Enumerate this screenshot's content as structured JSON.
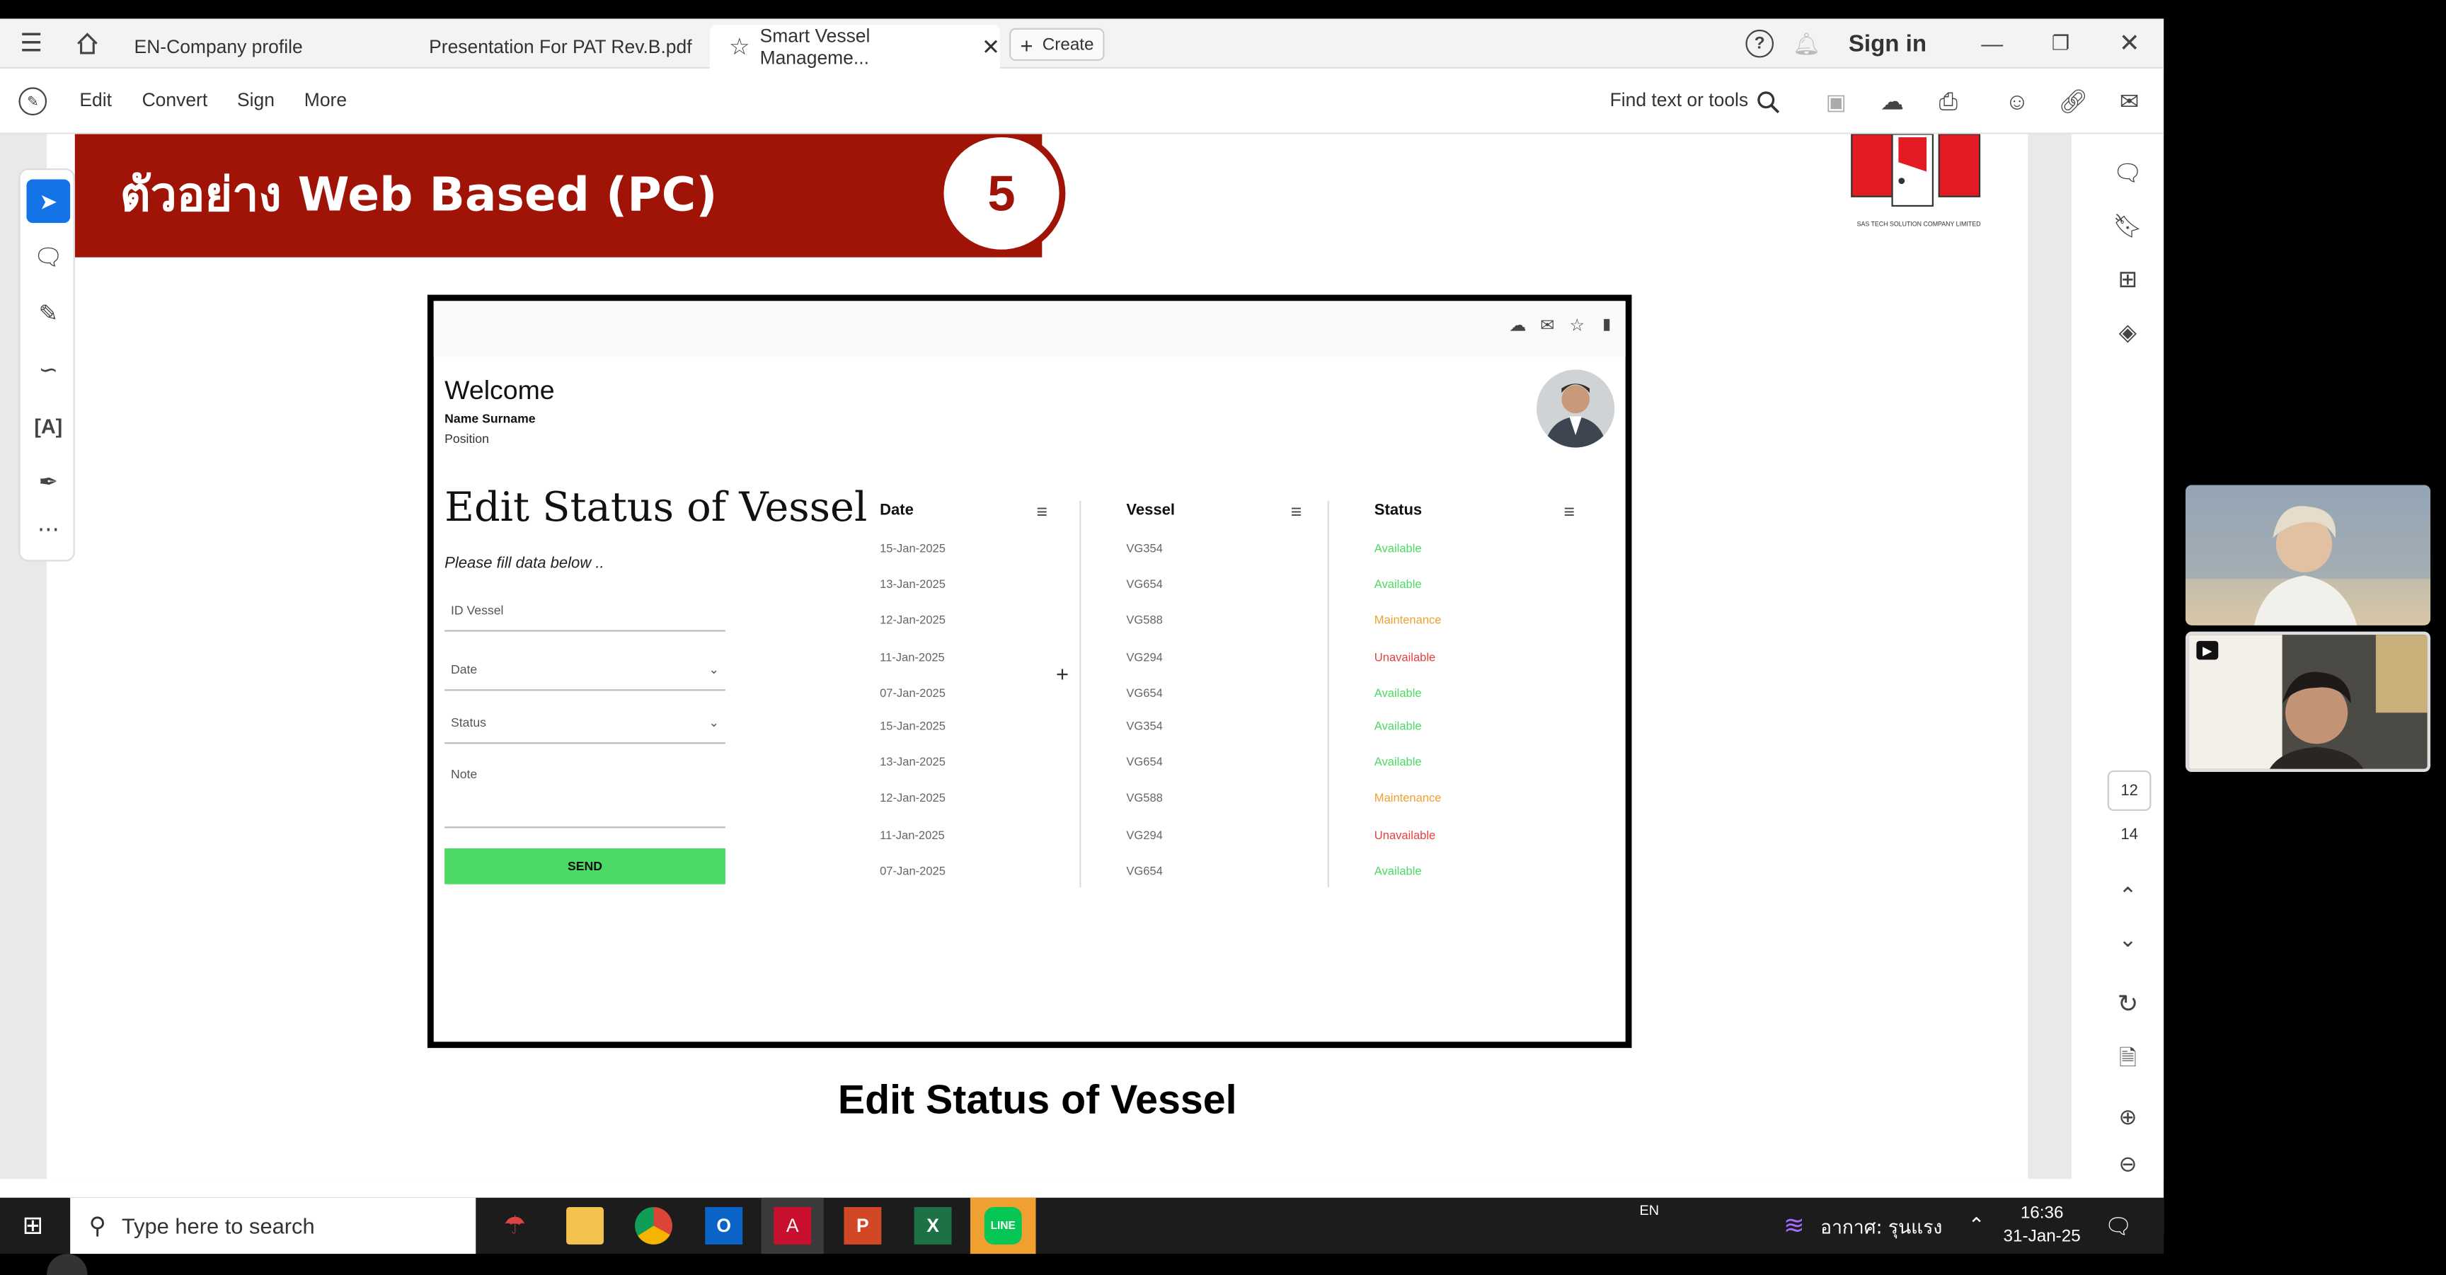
{
  "tabs": [
    {
      "label": "EN-Company profile"
    },
    {
      "label": "Presentation For PAT Rev.B.pdf"
    },
    {
      "label": "Smart Vessel Manageme..."
    }
  ],
  "create_label": "Create",
  "signin_label": "Sign in",
  "menu": {
    "edit": "Edit",
    "convert": "Convert",
    "sign": "Sign",
    "more": "More"
  },
  "find_label": "Find text or tools",
  "slide": {
    "banner": "ตัวอย่าง Web Based (PC)",
    "number": "5",
    "logo_text": "SAS TECH SOLUTION COMPANY LIMITED",
    "caption": "Edit Status of Vessel"
  },
  "app": {
    "welcome": "Welcome",
    "name": "Name Surname",
    "position": "Position",
    "heading": "Edit Status of Vessel",
    "subtitle": "Please fill data below ..",
    "fields": {
      "id": "ID Vessel",
      "date": "Date",
      "status": "Status",
      "note": "Note"
    },
    "send": "SEND",
    "columns": {
      "date": "Date",
      "vessel": "Vessel",
      "status": "Status"
    },
    "rows": [
      {
        "date": "15-Jan-2025",
        "vessel": "VG354",
        "status": "Available"
      },
      {
        "date": "13-Jan-2025",
        "vessel": "VG654",
        "status": "Available"
      },
      {
        "date": "12-Jan-2025",
        "vessel": "VG588",
        "status": "Maintenance"
      },
      {
        "date": "11-Jan-2025",
        "vessel": "VG294",
        "status": "Unavailable"
      },
      {
        "date": "07-Jan-2025",
        "vessel": "VG654",
        "status": "Available"
      },
      {
        "date": "15-Jan-2025",
        "vessel": "VG354",
        "status": "Available"
      },
      {
        "date": "13-Jan-2025",
        "vessel": "VG654",
        "status": "Available"
      },
      {
        "date": "12-Jan-2025",
        "vessel": "VG588",
        "status": "Maintenance"
      },
      {
        "date": "11-Jan-2025",
        "vessel": "VG294",
        "status": "Unavailable"
      },
      {
        "date": "07-Jan-2025",
        "vessel": "VG654",
        "status": "Available"
      }
    ]
  },
  "status_colors": {
    "Available": "#4cd964",
    "Maintenance": "#f0a030",
    "Unavailable": "#e84040"
  },
  "page_numbers": {
    "current": "12",
    "total": "14"
  },
  "taskbar": {
    "search": "Type here to search",
    "lang": "EN",
    "weather": "อากาศ: รุนแรง",
    "time": "16:36",
    "date": "31-Jan-25"
  },
  "colors": {
    "banner": "#a01408",
    "send": "#4cd964",
    "accent": "#1473e6"
  }
}
